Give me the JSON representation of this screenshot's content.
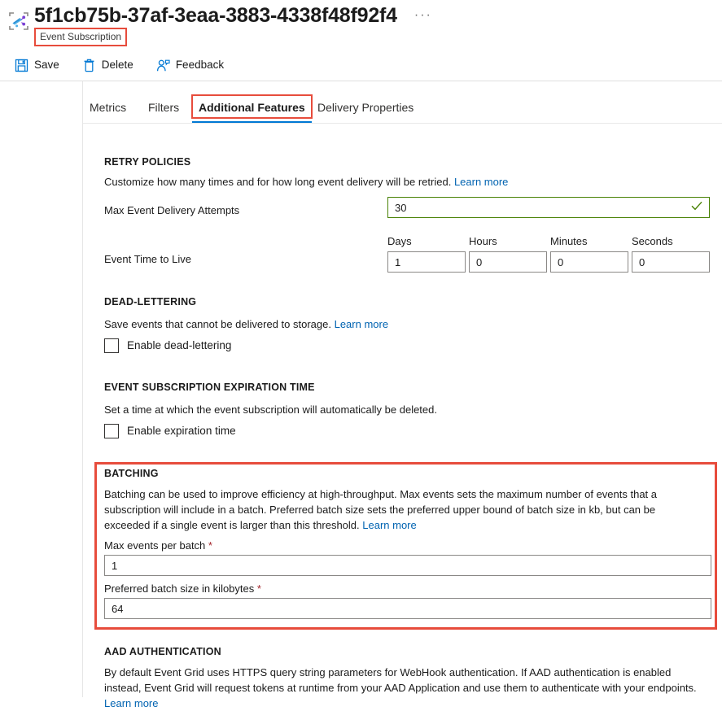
{
  "header": {
    "resource_icon": "event-grid-subscription-icon",
    "title": "5f1cb75b-37af-3eaa-3883-4338f48f92f4",
    "subtitle": "Event Subscription",
    "more_label": "···"
  },
  "commands": [
    {
      "label": "Save",
      "icon": "save-icon"
    },
    {
      "label": "Delete",
      "icon": "delete-icon"
    },
    {
      "label": "Feedback",
      "icon": "feedback-icon"
    }
  ],
  "tabs": [
    {
      "label": "Metrics",
      "active": false
    },
    {
      "label": "Filters",
      "active": false
    },
    {
      "label": "Additional Features",
      "active": true
    },
    {
      "label": "Delivery Properties",
      "active": false
    }
  ],
  "retry_policies": {
    "title": "RETRY POLICIES",
    "description": "Customize how many times and for how long event delivery will be retried.",
    "learn_more": "Learn more",
    "max_attempts": {
      "label": "Max Event Delivery Attempts",
      "value": "30",
      "valid": true
    },
    "ttl": {
      "label": "Event Time to Live",
      "columns": [
        {
          "label": "Days",
          "value": "1"
        },
        {
          "label": "Hours",
          "value": "0"
        },
        {
          "label": "Minutes",
          "value": "0"
        },
        {
          "label": "Seconds",
          "value": "0"
        }
      ]
    }
  },
  "dead_lettering": {
    "title": "DEAD-LETTERING",
    "description": "Save events that cannot be delivered to storage.",
    "learn_more": "Learn more",
    "checkbox_label": "Enable dead-lettering",
    "checked": false
  },
  "expiration": {
    "title": "EVENT SUBSCRIPTION EXPIRATION TIME",
    "description": "Set a time at which the event subscription will automatically be deleted.",
    "checkbox_label": "Enable expiration time",
    "checked": false
  },
  "batching": {
    "title": "BATCHING",
    "description": "Batching can be used to improve efficiency at high-throughput. Max events sets the maximum number of events that a subscription will include in a batch. Preferred batch size sets the preferred upper bound of batch size in kb, but can be exceeded if a single event is larger than this threshold.",
    "learn_more": "Learn more",
    "max_events": {
      "label": "Max events per batch",
      "required": "*",
      "value": "1"
    },
    "batch_size": {
      "label": "Preferred batch size in kilobytes",
      "required": "*",
      "value": "64"
    }
  },
  "aad": {
    "title": "AAD AUTHENTICATION",
    "description": "By default Event Grid uses HTTPS query string parameters for WebHook authentication. If AAD authentication is enabled instead, Event Grid will request tokens at runtime from your AAD Application and use them to authenticate with your endpoints.",
    "learn_more": "Learn more"
  },
  "colors": {
    "accent": "#0078d4",
    "highlight": "#e74c3c",
    "link": "#0063b1",
    "valid": "#498205",
    "required": "#a4262c"
  }
}
